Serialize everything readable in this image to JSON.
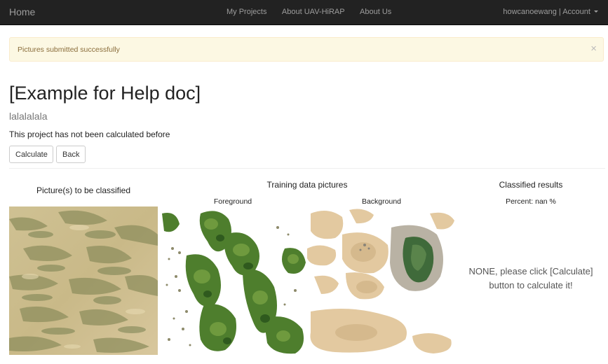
{
  "navbar": {
    "brand": "Home",
    "links": [
      "My Projects",
      "About UAV-HiRAP",
      "About Us"
    ],
    "user": "howcanoewang",
    "separator": "|",
    "account": "Account"
  },
  "alert": {
    "message": "Pictures submitted successfully",
    "close": "×"
  },
  "project": {
    "title": "[Example for Help doc]",
    "subtitle": "lalalalala",
    "status": "This project has not been calculated before"
  },
  "buttons": {
    "calculate": "Calculate",
    "back": "Back"
  },
  "sections": {
    "to_classify": "Picture(s) to be classified",
    "training": "Training data pictures",
    "foreground": "Foreground",
    "background": "Background",
    "results": "Classified results",
    "percent_label": "Percent:",
    "percent_value": "nan %",
    "none_line1": "NONE, please click [Calculate]",
    "none_line2": "button to calculate it!"
  },
  "colors": {
    "navbar": "#222222",
    "alert_bg": "#fcf8e3",
    "sand": "#d9c79b",
    "vegetation": "#4a7a2e",
    "water": "#4a6b3c"
  }
}
